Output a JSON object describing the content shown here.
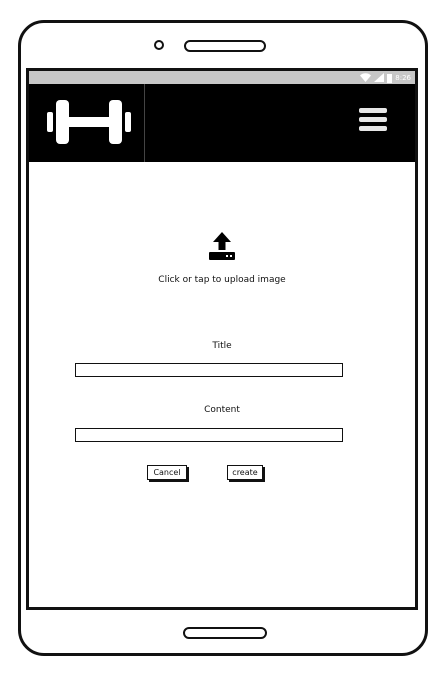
{
  "status_bar": {
    "time": "8:26"
  },
  "header": {
    "logo_icon": "dumbbell-icon",
    "menu_icon": "hamburger-menu-icon"
  },
  "upload": {
    "icon": "upload-icon",
    "label": "Click or tap to upload image"
  },
  "form": {
    "title_label": "Title",
    "title_value": "",
    "content_label": "Content",
    "content_value": "",
    "cancel_label": "Cancel",
    "create_label": "create"
  }
}
